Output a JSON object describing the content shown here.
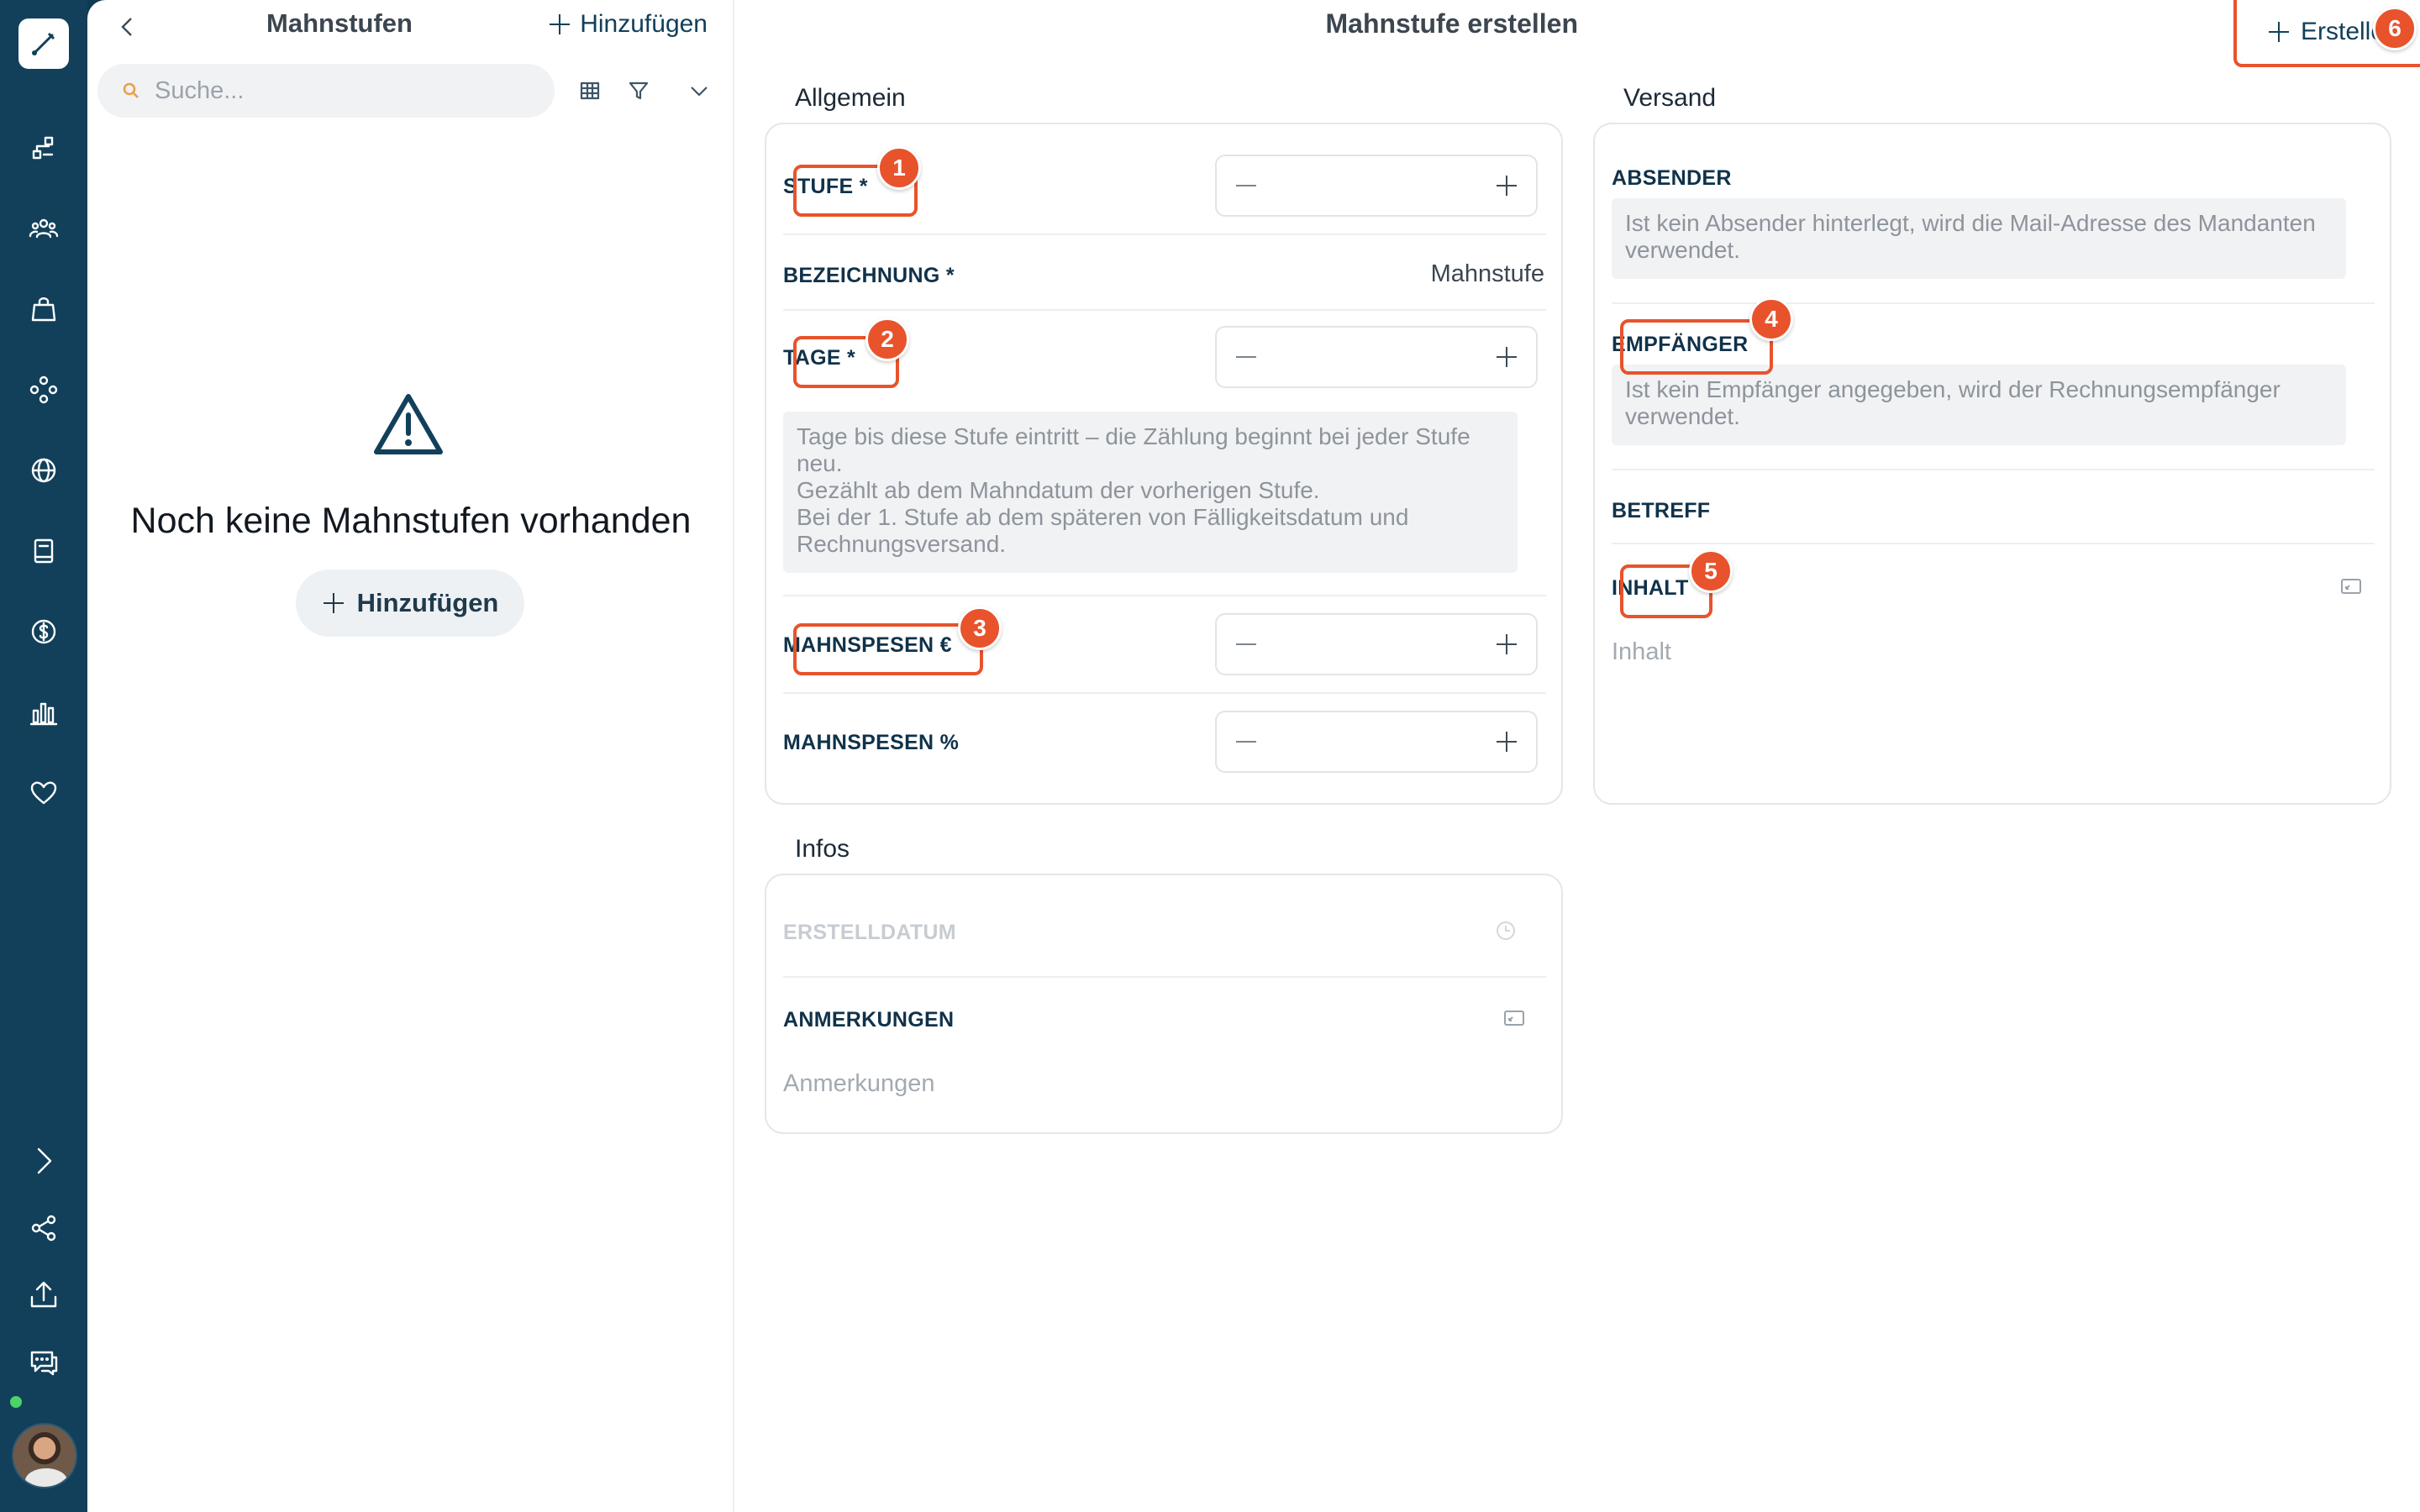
{
  "list_panel": {
    "title": "Mahnstufen",
    "add_label": "Hinzufügen",
    "search_placeholder": "Suche...",
    "empty_text": "Noch keine Mahnstufen vorhanden",
    "empty_add_label": "Hinzufügen"
  },
  "main": {
    "title": "Mahnstufe erstellen",
    "create_label": "Erstellen"
  },
  "general": {
    "title": "Allgemein",
    "stufe_label": "STUFE *",
    "bezeichnung_label": "BEZEICHNUNG *",
    "bezeichnung_value": "Mahnstufe",
    "tage_label": "TAGE *",
    "tage_hint": "Tage bis diese Stufe eintritt – die Zählung beginnt bei jeder Stufe neu.\nGezählt ab dem Mahndatum der vorherigen Stufe.\nBei der 1. Stufe ab dem späteren von Fälligkeitsdatum und Rechnungsversand.",
    "mahnspesen_eur_label": "MAHNSPESEN €",
    "mahnspesen_pct_label": "MAHNSPESEN %"
  },
  "shipping": {
    "title": "Versand",
    "absender_label": "ABSENDER",
    "absender_hint": "Ist kein Absender hinterlegt, wird die Mail-Adresse des Mandanten verwendet.",
    "empfaenger_label": "EMPFÄNGER",
    "empfaenger_hint": "Ist kein Empfänger angegeben, wird der Rechnungsempfänger verwendet.",
    "betreff_label": "BETREFF",
    "inhalt_label": "INHALT",
    "inhalt_placeholder": "Inhalt"
  },
  "infos": {
    "title": "Infos",
    "erstelldatum_label": "ERSTELLDATUM",
    "anmerkungen_label": "ANMERKUNGEN",
    "anmerkungen_placeholder": "Anmerkungen"
  },
  "badges": [
    "1",
    "2",
    "3",
    "4",
    "5",
    "6"
  ],
  "colors": {
    "accent": "#e8532c",
    "rail": "#12405a",
    "online": "#4bd36b"
  },
  "rail_icons": [
    "brush-icon",
    "process-icon",
    "users-icon",
    "bag-icon",
    "network-icon",
    "globe-icon",
    "book-icon",
    "dollar-icon",
    "chart-icon",
    "heart-icon",
    "chevron-right-icon",
    "share-icon",
    "upload-icon",
    "chat-icon"
  ]
}
